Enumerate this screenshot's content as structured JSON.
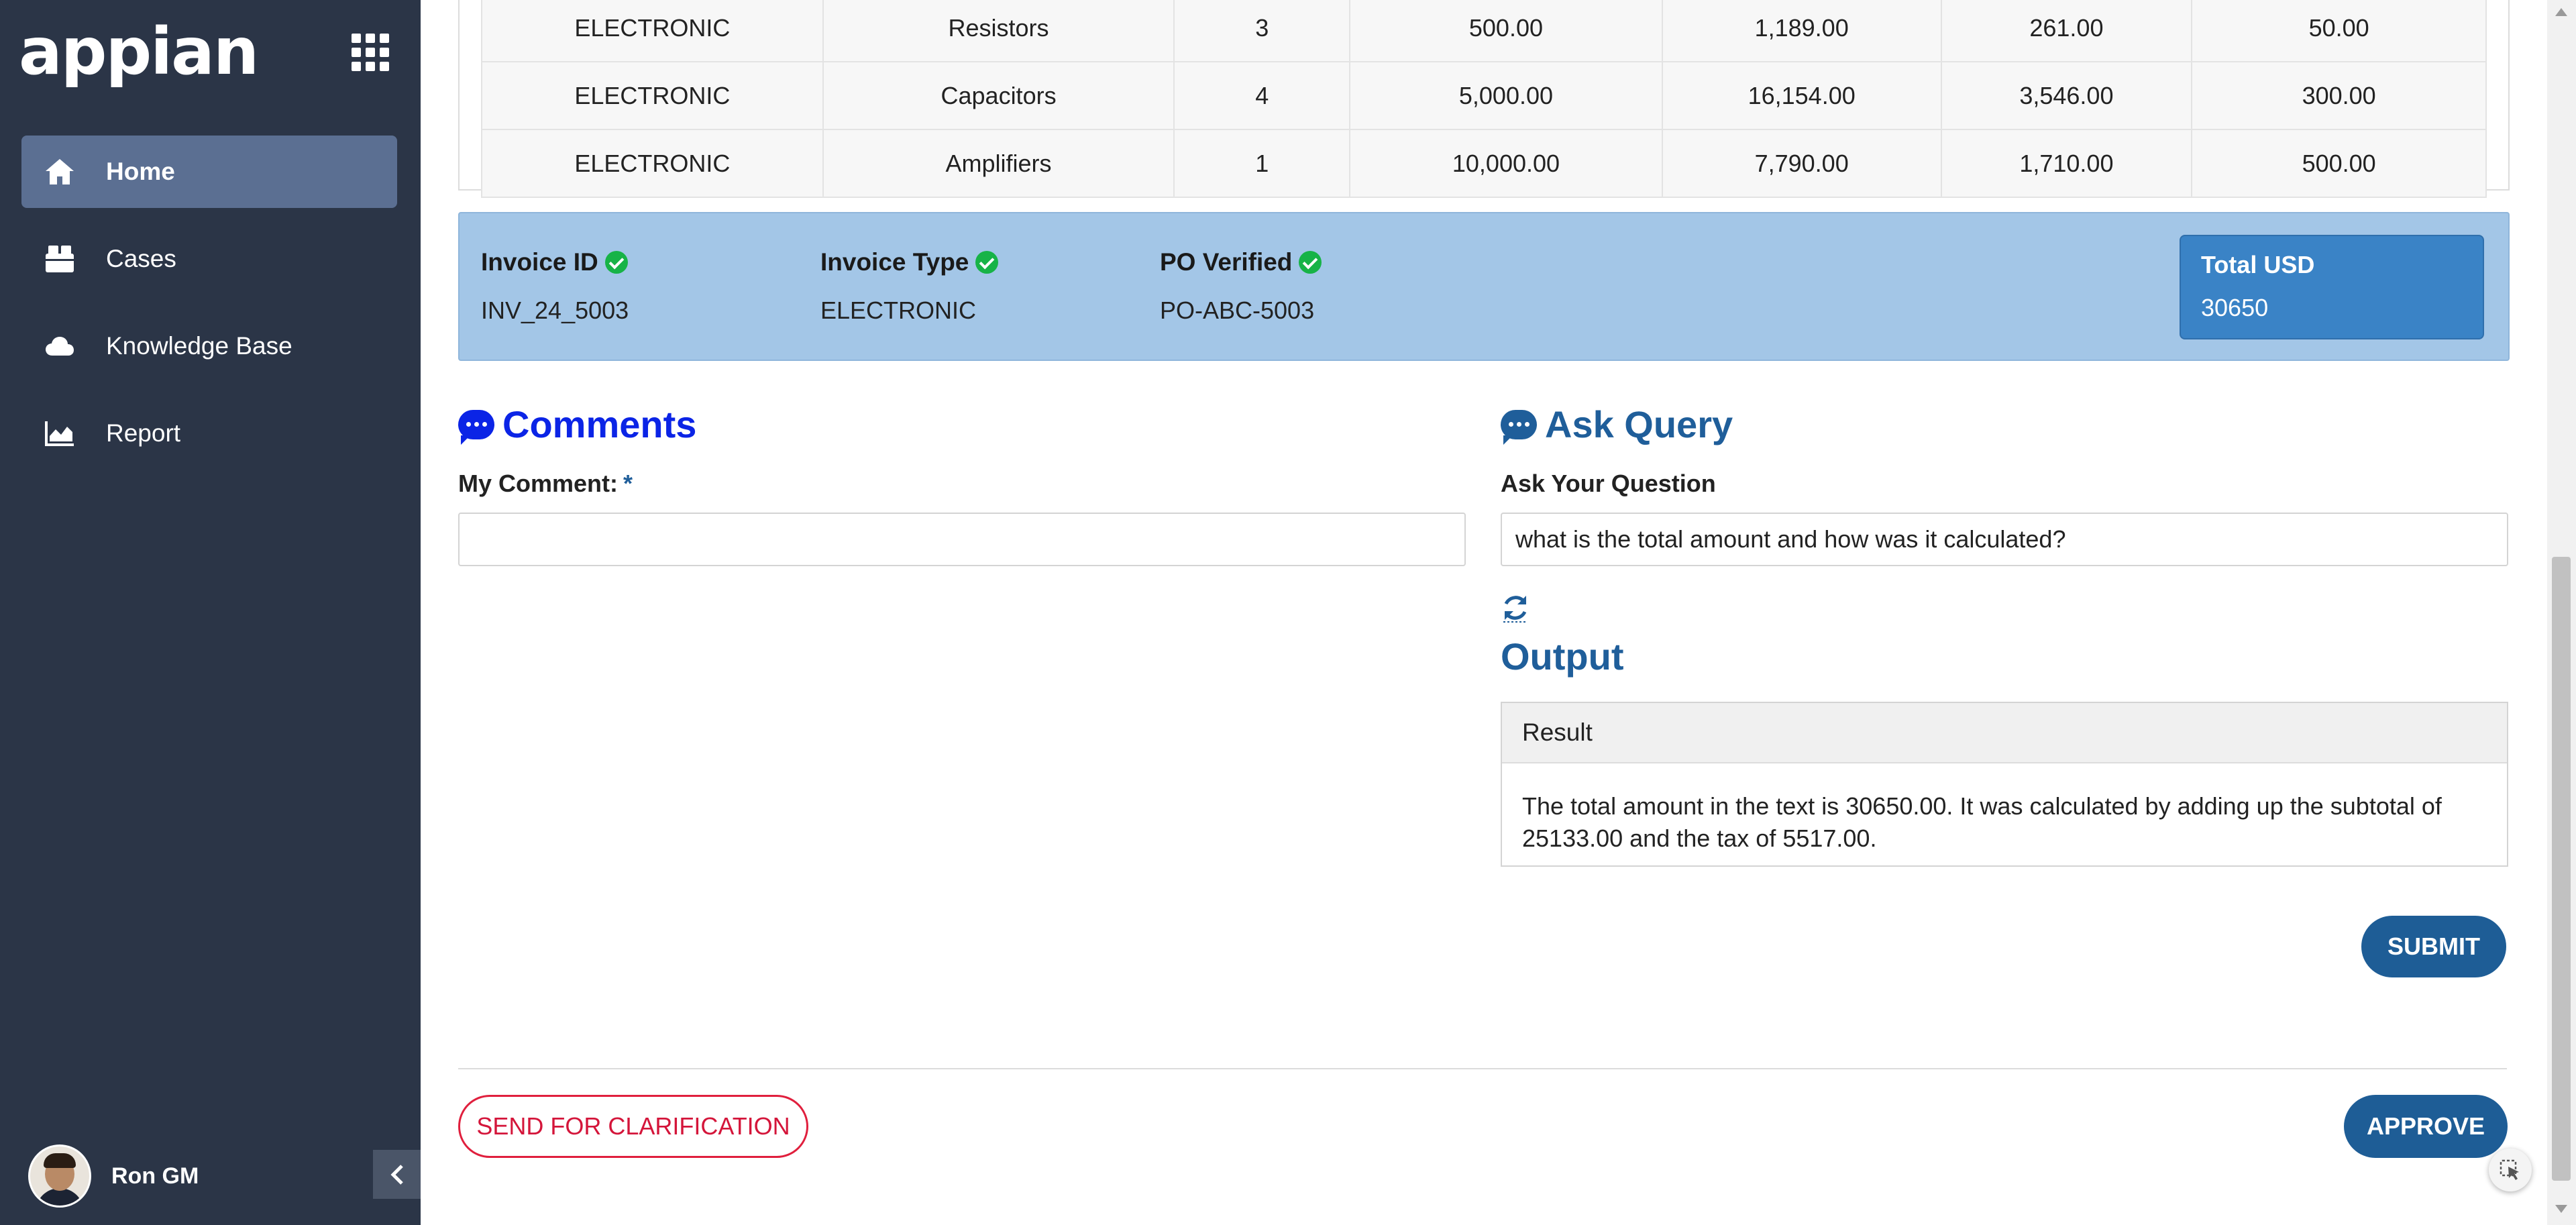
{
  "sidebar": {
    "logo": "appian",
    "items": [
      {
        "label": "Home",
        "icon": "home-icon"
      },
      {
        "label": "Cases",
        "icon": "cases-icon"
      },
      {
        "label": "Knowledge Base",
        "icon": "cloud-icon"
      },
      {
        "label": "Report",
        "icon": "chart-icon"
      }
    ],
    "active": "Home",
    "user": {
      "name": "Ron GM"
    }
  },
  "line_items": {
    "rows": [
      [
        "ELECTRONIC",
        "Resistors",
        "3",
        "500.00",
        "1,189.00",
        "261.00",
        "50.00"
      ],
      [
        "ELECTRONIC",
        "Capacitors",
        "4",
        "5,000.00",
        "16,154.00",
        "3,546.00",
        "300.00"
      ],
      [
        "ELECTRONIC",
        "Amplifiers",
        "1",
        "10,000.00",
        "7,790.00",
        "1,710.00",
        "500.00"
      ]
    ]
  },
  "summary": {
    "invoice_id_label": "Invoice ID",
    "invoice_id": "INV_24_5003",
    "invoice_type_label": "Invoice Type",
    "invoice_type": "ELECTRONIC",
    "po_verified_label": "PO Verified",
    "po_verified": "PO-ABC-5003",
    "total_label": "Total USD",
    "total_value": "30650"
  },
  "comments": {
    "title": "Comments",
    "field_label": "My Comment:",
    "required_marker": "*",
    "value": ""
  },
  "query": {
    "title": "Ask Query",
    "field_label": "Ask Your Question",
    "value": "what is the total amount and how was it calculated?",
    "output_title": "Output",
    "result_header": "Result",
    "result_text": "The total amount in the text is 30650.00. It was calculated by adding up the subtotal of 25133.00 and the tax of 5517.00.",
    "submit_label": "SUBMIT"
  },
  "actions": {
    "clarification_label": "SEND FOR CLARIFICATION",
    "approve_label": "APPROVE"
  },
  "colors": {
    "sidebar_bg": "#2b3547",
    "summary_bg": "#a3c6e7",
    "total_box_bg": "#3a83c6",
    "primary_button": "#1e5d96",
    "clarification_red": "#e01f3d",
    "comments_blue": "#0b24e6"
  }
}
